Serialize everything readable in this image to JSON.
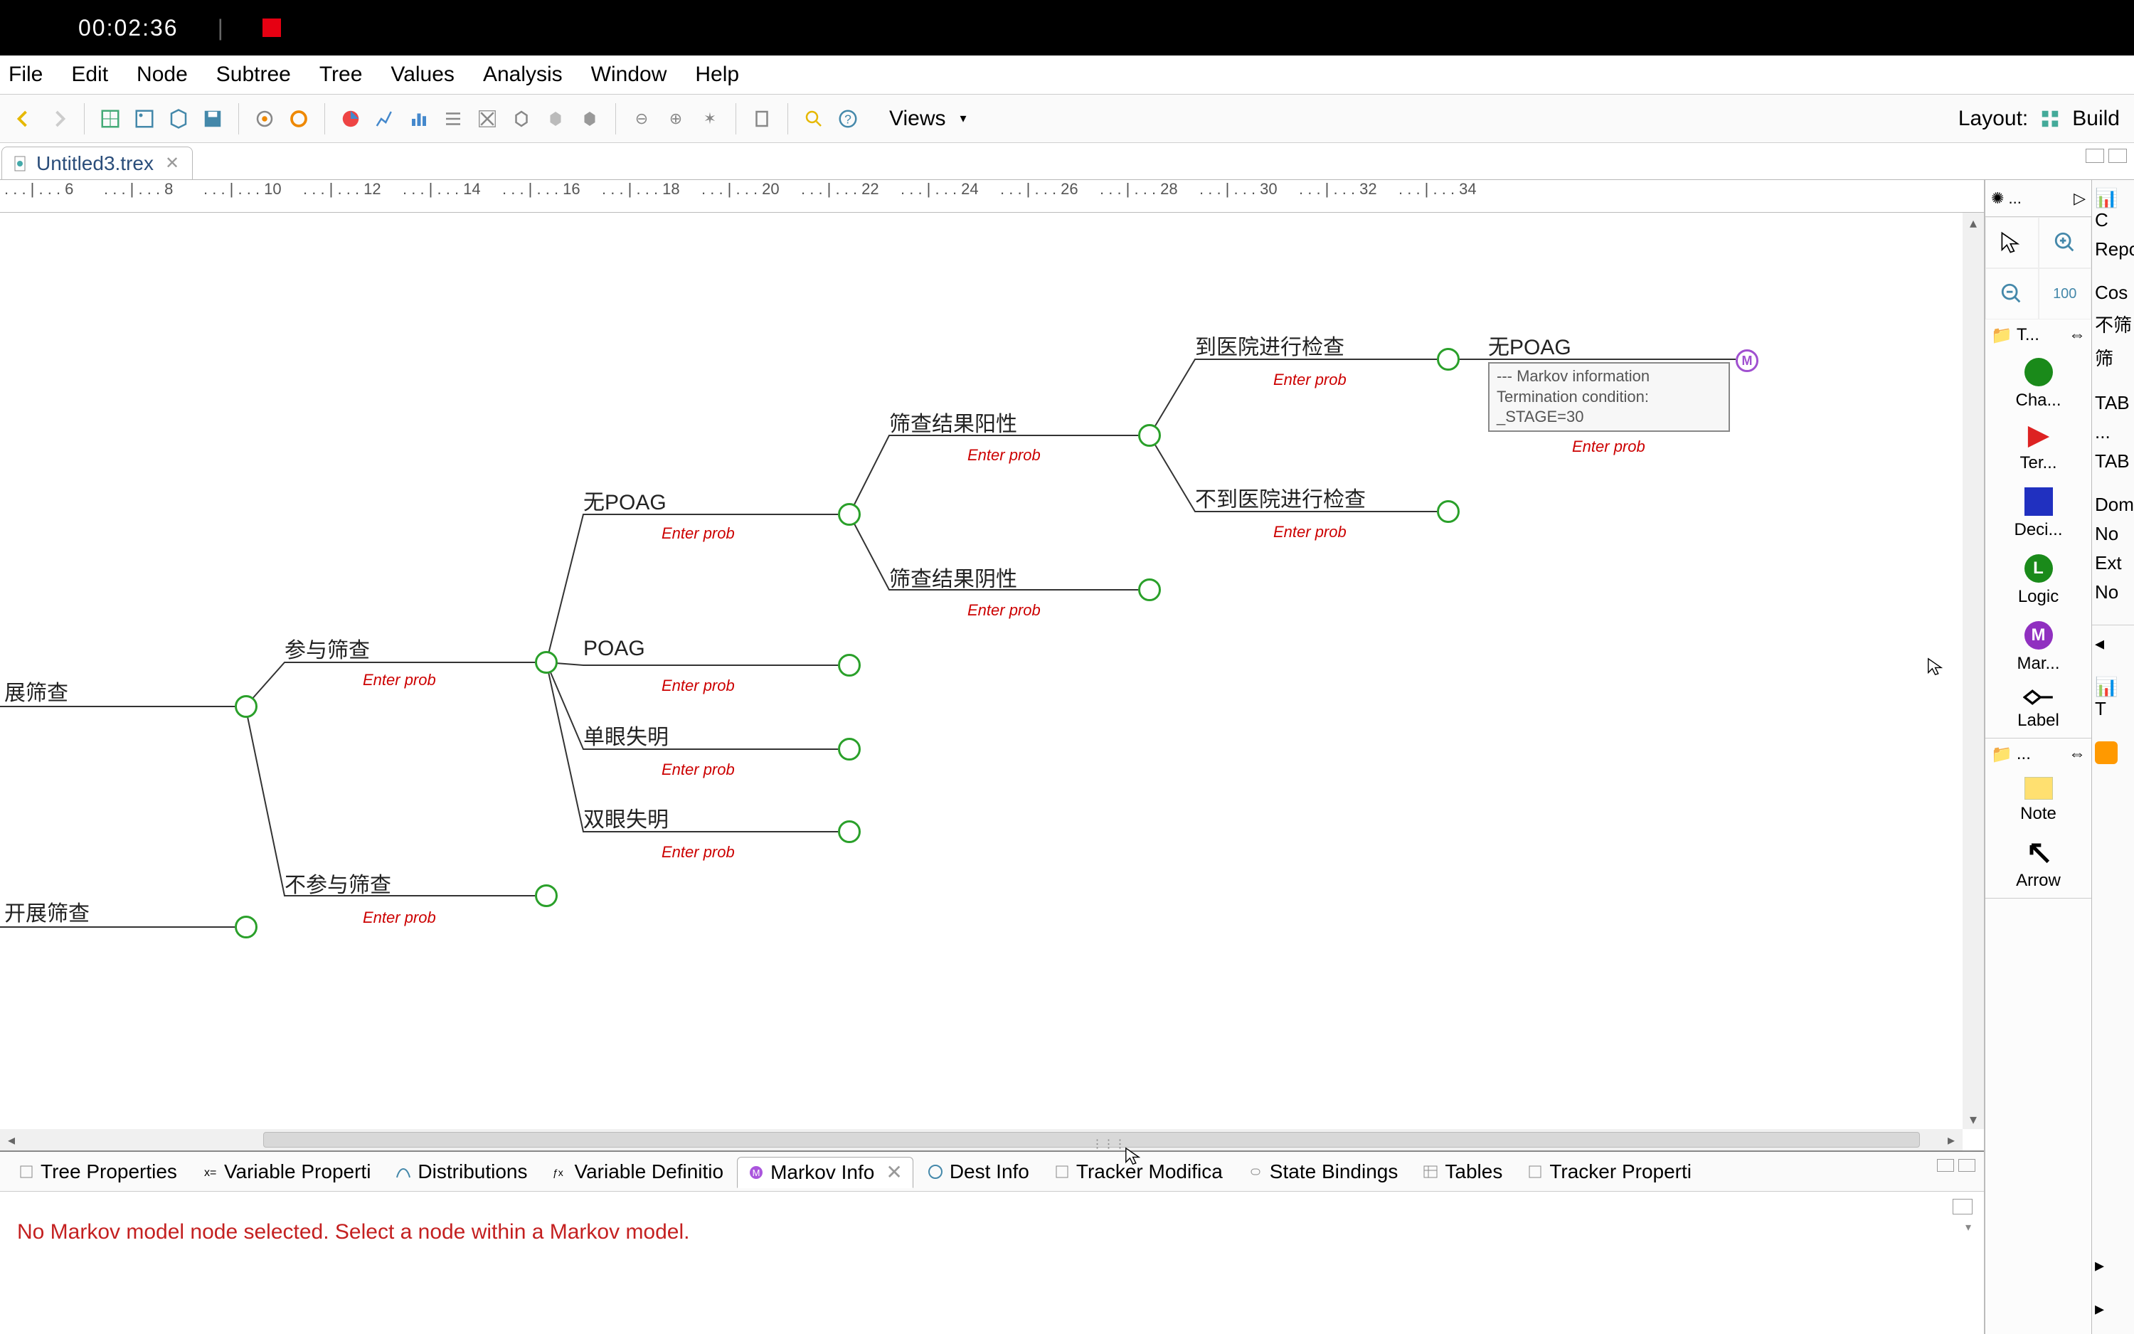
{
  "topbar": {
    "time": "00:02:36"
  },
  "menus": [
    "File",
    "Edit",
    "Node",
    "Subtree",
    "Tree",
    "Values",
    "Analysis",
    "Window",
    "Help"
  ],
  "toolbar": {
    "views_label": "Views",
    "layout_label": "Layout:",
    "build_label": "Build"
  },
  "doctab": {
    "title": "Untitled3.trex"
  },
  "ruler": {
    "start": 6,
    "step": 2,
    "count": 15
  },
  "tree": {
    "enter_prob": "Enter prob",
    "root1": "展筛查",
    "root2": "开展筛查",
    "n1": "参与筛查",
    "n2": "不参与筛查",
    "n3": "无POAG",
    "n4": "POAG",
    "n5": "单眼失明",
    "n6": "双眼失明",
    "n7": "筛查结果阳性",
    "n8": "筛查结果阴性",
    "n9": "到医院进行检查",
    "n10": "不到医院进行检查",
    "n11": "无POAG",
    "markov": {
      "l1": "--- Markov information",
      "l2": "Termination condition:",
      "l3": "_STAGE=30"
    }
  },
  "palette": {
    "section_t": "T...",
    "items": {
      "chance": "Cha...",
      "terminal": "Ter...",
      "decision": "Deci...",
      "logic": "Logic",
      "markov": "Mar...",
      "label": "Label",
      "note": "Note",
      "arrow": "Arrow"
    },
    "section2": "..."
  },
  "bottom_tabs": {
    "tree_props": "Tree Properties",
    "var_props": "Variable Properti",
    "dist": "Distributions",
    "var_def": "Variable Definitio",
    "markov": "Markov Info",
    "dest": "Dest Info",
    "tracker_mod": "Tracker Modifica",
    "state_bind": "State Bindings",
    "tables": "Tables",
    "tracker_prop": "Tracker Properti"
  },
  "bottom_msg": "No Markov model node selected. Select a node within a Markov model.",
  "rightpanel": {
    "c": "C",
    "repo": "Repo",
    "cos": "Cos",
    "a1": "不筛",
    "a2": "筛",
    "tab1": "TAB",
    "dots": "...",
    "tab2": "TAB",
    "dom": "Dom",
    "no1": "No",
    "ext": "Ext",
    "no2": "No",
    "t": "T"
  }
}
